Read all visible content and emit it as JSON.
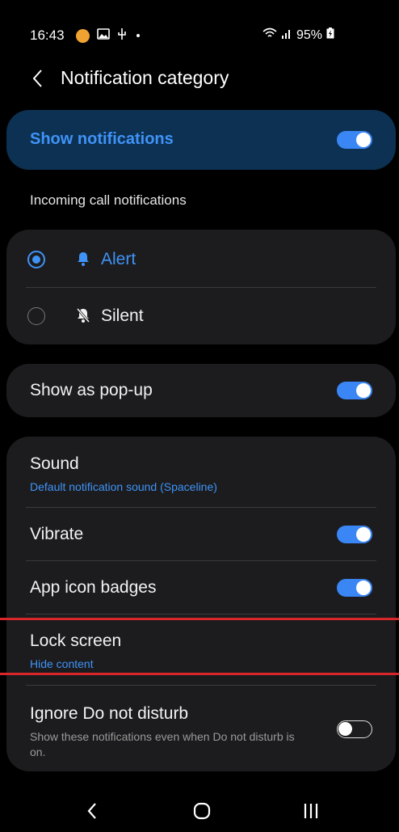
{
  "status_bar": {
    "time": "16:43",
    "battery": "95%",
    "icons": [
      "app-notification-icon",
      "gallery-icon",
      "usb-icon",
      "dot-icon",
      "wifi-icon",
      "signal-icon",
      "battery-charging-icon"
    ]
  },
  "header": {
    "title": "Notification category",
    "back_icon": "chevron-left-icon"
  },
  "master": {
    "label": "Show notifications",
    "enabled": true
  },
  "section": {
    "label": "Incoming call notifications"
  },
  "radio_options": [
    {
      "label": "Alert",
      "selected": true,
      "icon": "bell-icon"
    },
    {
      "label": "Silent",
      "selected": false,
      "icon": "bell-off-icon"
    }
  ],
  "popup": {
    "label": "Show as pop-up",
    "enabled": true
  },
  "settings": {
    "sound_label": "Sound",
    "sound_value": "Default notification sound (Spaceline)",
    "vibrate_label": "Vibrate",
    "vibrate_enabled": true,
    "badges_label": "App icon badges",
    "badges_enabled": true,
    "lock_label": "Lock screen",
    "lock_value": "Hide content",
    "dnd_label": "Ignore Do not disturb",
    "dnd_desc": "Show these notifications even when Do not disturb is on.",
    "dnd_enabled": false
  },
  "navbar": {
    "back": "back-icon",
    "home": "home-icon",
    "recents": "recents-icon"
  },
  "colors": {
    "accent": "#3f93f7",
    "highlight_line": "#d8262a",
    "card": "#1c1c1e",
    "master_card": "#0d3152"
  }
}
